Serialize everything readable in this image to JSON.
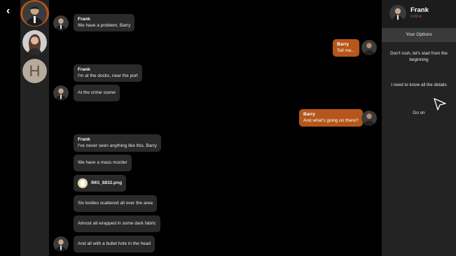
{
  "contacts": [
    {
      "name": "Frank",
      "initial": "",
      "active": true
    },
    {
      "name": "Woman",
      "initial": "",
      "active": false
    },
    {
      "name": "H",
      "initial": "H",
      "active": false
    }
  ],
  "messages": [
    {
      "from": "Frank",
      "name": "Frank",
      "text": "We have a problem, Barry"
    },
    {
      "from": "Barry",
      "name": "Barry",
      "text": "Tell me..."
    },
    {
      "from": "Frank",
      "name": "Frank",
      "text": "I'm at the docks, near the port"
    },
    {
      "from": "Frank",
      "name": "",
      "text": "At the crime scene"
    },
    {
      "from": "Barry",
      "name": "Barry",
      "text": "And what's going on there?"
    },
    {
      "from": "Frank",
      "name": "Frank",
      "text": "I've never seen anything like this, Barry"
    },
    {
      "from": "Frank",
      "name": "",
      "text": "We have a mass murder"
    },
    {
      "from": "Frank",
      "name": "",
      "text": "IMG_8832.png",
      "file": true
    },
    {
      "from": "Frank",
      "name": "",
      "text": "Six bodies scattered all over the area"
    },
    {
      "from": "Frank",
      "name": "",
      "text": "Almost all wrapped in some dark fabric"
    },
    {
      "from": "Frank",
      "name": "",
      "text": "And all with a bullet hole in the head"
    }
  ],
  "panel": {
    "name": "Frank",
    "status": "online",
    "options_header": "Your Options",
    "options": [
      "Don't rush, let's start from the beginning",
      "I need to know all the details",
      "Go on"
    ]
  },
  "icons": {
    "back": "chevron-left-icon",
    "file": "image-file-icon",
    "cursor": "pointer-cursor-icon"
  },
  "colors": {
    "accent": "#b5561b",
    "bubble": "#2a2a2a",
    "background": "#000000",
    "sidebar": "#232323"
  }
}
